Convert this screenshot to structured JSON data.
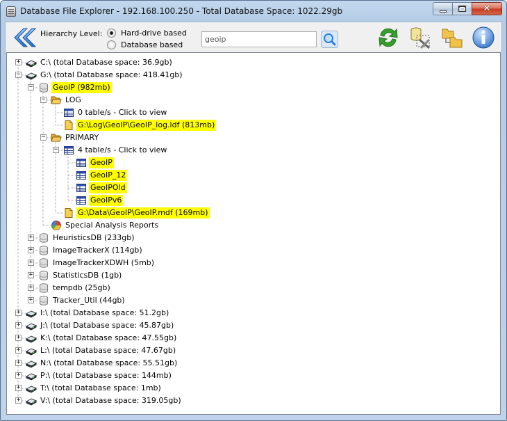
{
  "window": {
    "title": "Database File Explorer - 192.168.100.250 - Total Database Space: 1022.29gb",
    "min_icon": "minimize-icon",
    "max_icon": "maximize-icon",
    "close_icon": "close-icon",
    "close_glyph": "✕"
  },
  "toolbar": {
    "back_icon": "back-arrow-icon",
    "hierarchy_label": "Hierarchy Level:",
    "options": [
      {
        "label": "Hard-drive based",
        "selected": true
      },
      {
        "label": "Database based",
        "selected": false
      }
    ],
    "search_value": "geoip",
    "search_icon": "search-icon",
    "refresh_icon": "refresh-icon",
    "tools_icon": "database-tools-icon",
    "folders_icon": "folders-icon",
    "info_icon": "info-icon"
  },
  "colors": {
    "highlight": "#ffff00",
    "accent_blue": "#2f7ed8",
    "refresh_green": "#35a02c"
  },
  "tree": [
    {
      "label": "C:\\ (total Database space: 36.9gb)",
      "icon": "drive-icon",
      "level": 0,
      "expander": "+",
      "highlight": false
    },
    {
      "label": "G:\\ (total Database space: 418.41gb)",
      "icon": "drive-icon",
      "level": 0,
      "expander": "-",
      "highlight": false
    },
    {
      "label": "GeoIP (982mb)",
      "icon": "database-icon",
      "level": 1,
      "expander": "-",
      "highlight": true
    },
    {
      "label": "LOG",
      "icon": "folder-open-icon",
      "level": 2,
      "expander": "-",
      "highlight": false
    },
    {
      "label": "0 table/s - Click to view",
      "icon": "table-icon",
      "level": 3,
      "expander": "",
      "highlight": false
    },
    {
      "label": "G:\\Log\\GeoIP\\GeoIP_log.ldf (813mb)",
      "icon": "file-icon",
      "level": 3,
      "expander": "",
      "highlight": true
    },
    {
      "label": "PRIMARY",
      "icon": "folder-open-icon",
      "level": 2,
      "expander": "-",
      "highlight": false
    },
    {
      "label": "4 table/s - Click to view",
      "icon": "table-icon",
      "level": 3,
      "expander": "-",
      "highlight": false
    },
    {
      "label": "GeoIP",
      "icon": "table-icon",
      "level": 4,
      "expander": "",
      "highlight": true
    },
    {
      "label": "GeoIP_12",
      "icon": "table-icon",
      "level": 4,
      "expander": "",
      "highlight": true
    },
    {
      "label": "GeoIPOld",
      "icon": "table-icon",
      "level": 4,
      "expander": "",
      "highlight": true
    },
    {
      "label": "GeoIPv6",
      "icon": "table-icon",
      "level": 4,
      "expander": "",
      "highlight": true
    },
    {
      "label": "G:\\Data\\GeoIP\\GeoIP.mdf (169mb)",
      "icon": "file-icon",
      "level": 3,
      "expander": "",
      "highlight": true
    },
    {
      "label": "Special Analysis Reports",
      "icon": "pie-chart-icon",
      "level": 2,
      "expander": "",
      "highlight": false
    },
    {
      "label": "HeuristicsDB (233gb)",
      "icon": "database-icon",
      "level": 1,
      "expander": "+",
      "highlight": false
    },
    {
      "label": "ImageTrackerX (114gb)",
      "icon": "database-icon",
      "level": 1,
      "expander": "+",
      "highlight": false
    },
    {
      "label": "ImageTrackerXDWH (5mb)",
      "icon": "database-icon",
      "level": 1,
      "expander": "+",
      "highlight": false
    },
    {
      "label": "StatisticsDB (1gb)",
      "icon": "database-icon",
      "level": 1,
      "expander": "+",
      "highlight": false
    },
    {
      "label": "tempdb (25gb)",
      "icon": "database-icon",
      "level": 1,
      "expander": "+",
      "highlight": false
    },
    {
      "label": "Tracker_Util (44gb)",
      "icon": "database-icon",
      "level": 1,
      "expander": "+",
      "highlight": false
    },
    {
      "label": "I:\\ (total Database space: 51.2gb)",
      "icon": "drive-icon",
      "level": 0,
      "expander": "+",
      "highlight": false
    },
    {
      "label": "J:\\ (total Database space: 45.87gb)",
      "icon": "drive-icon",
      "level": 0,
      "expander": "+",
      "highlight": false
    },
    {
      "label": "K:\\ (total Database space: 47.55gb)",
      "icon": "drive-icon",
      "level": 0,
      "expander": "+",
      "highlight": false
    },
    {
      "label": "L:\\ (total Database space: 47.67gb)",
      "icon": "drive-icon",
      "level": 0,
      "expander": "+",
      "highlight": false
    },
    {
      "label": "N:\\ (total Database space: 55.51gb)",
      "icon": "drive-icon",
      "level": 0,
      "expander": "+",
      "highlight": false
    },
    {
      "label": "P:\\ (total Database space: 144mb)",
      "icon": "drive-icon",
      "level": 0,
      "expander": "+",
      "highlight": false
    },
    {
      "label": "T:\\ (total Database space: 1mb)",
      "icon": "drive-icon",
      "level": 0,
      "expander": "+",
      "highlight": false
    },
    {
      "label": "V:\\ (total Database space: 319.05gb)",
      "icon": "drive-icon",
      "level": 0,
      "expander": "+",
      "highlight": false
    }
  ]
}
